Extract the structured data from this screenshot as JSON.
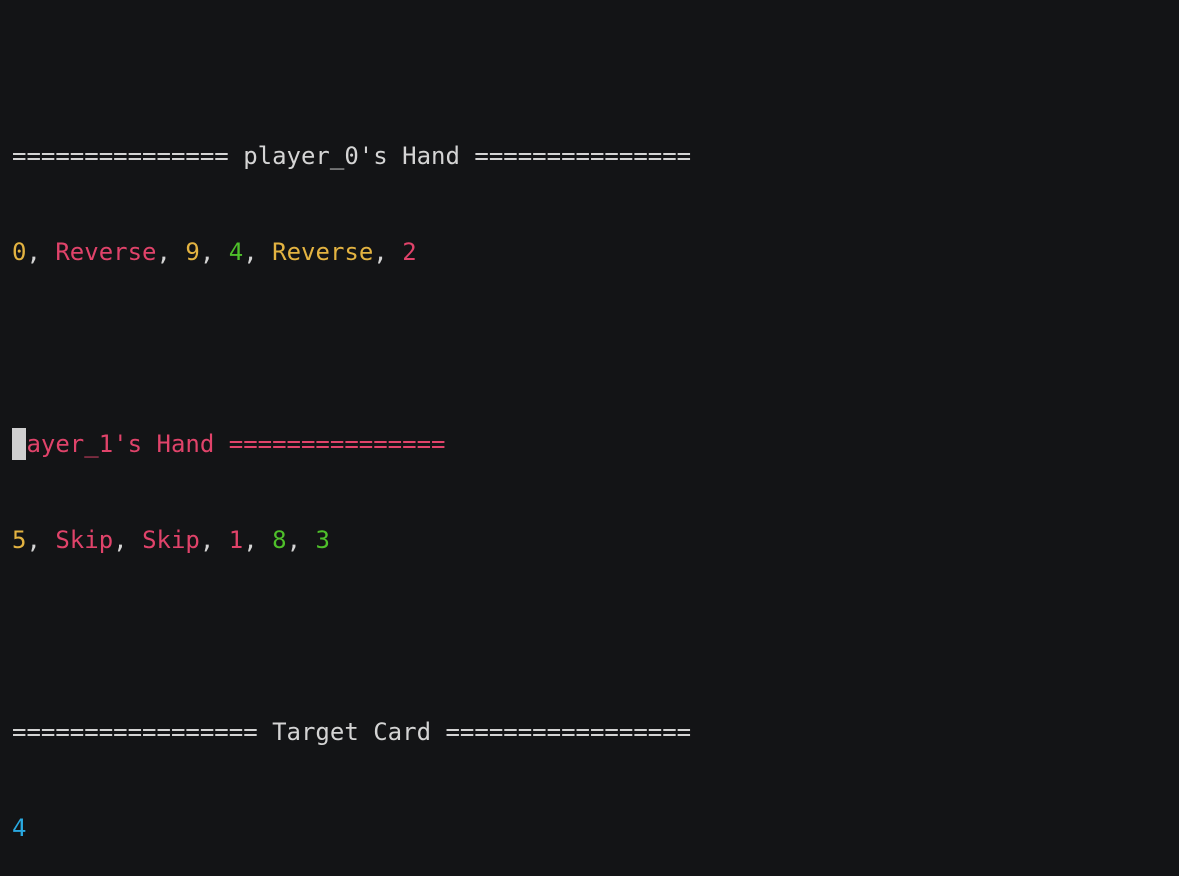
{
  "colors": {
    "background": "#131416",
    "text": "#d4d4d4",
    "yellow": "#e3b341",
    "red": "#e0436a",
    "green": "#4ec02a",
    "blue": "#29a8e0"
  },
  "player0": {
    "header": "=============== player_0's Hand ===============",
    "cards": [
      {
        "label": "0",
        "color": "yellow"
      },
      {
        "label": "Reverse",
        "color": "red"
      },
      {
        "label": "9",
        "color": "yellow"
      },
      {
        "label": "4",
        "color": "green"
      },
      {
        "label": "Reverse",
        "color": "yellow"
      },
      {
        "label": "2",
        "color": "red"
      }
    ]
  },
  "player1": {
    "header": "layer_1's Hand ===============",
    "cards": [
      {
        "label": "5",
        "color": "yellow"
      },
      {
        "label": "Skip",
        "color": "red"
      },
      {
        "label": "Skip",
        "color": "red"
      },
      {
        "label": "1",
        "color": "red"
      },
      {
        "label": "8",
        "color": "green"
      },
      {
        "label": "3",
        "color": "green"
      }
    ]
  },
  "target": {
    "header": "================= Target Card =================",
    "card": {
      "label": "4",
      "color": "blue"
    }
  },
  "separator": ", "
}
